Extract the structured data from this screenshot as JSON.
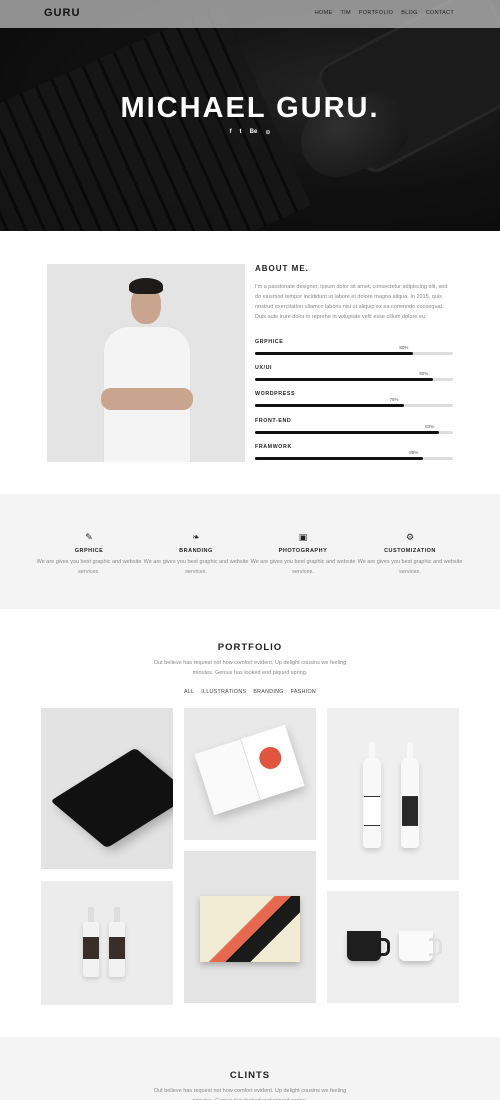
{
  "header": {
    "logo": "GURU",
    "nav": [
      "HOME",
      "TIM",
      "PORTFOLIO",
      "BLOG",
      "CONTACT"
    ]
  },
  "hero": {
    "title": "MICHAEL GURU.",
    "socials": [
      "f",
      "t",
      "Be",
      "⊙"
    ]
  },
  "about": {
    "title": "ABOUT ME.",
    "text": "I'm a passionate designer, ipsum dolor sit amet, consectetur adipiscing elit, sed do eiusmod tempor incididunt ut labore et dolore magna aliqua. In 2015, quis nostrud exercitation ullamco laboris nisi ut aliquip ex ea commodo consequat. Duis aute irure dolor in reprehe in voluptate velit esse cillum dolore eu.",
    "skills": [
      {
        "name": "GRPHICE",
        "value": 80,
        "label": "80%"
      },
      {
        "name": "UX/UI",
        "value": 90,
        "label": "90%"
      },
      {
        "name": "WORDPRESS",
        "value": 75,
        "label": "75%"
      },
      {
        "name": "FRONT-END",
        "value": 93,
        "label": "93%"
      },
      {
        "name": "FRAMWORK",
        "value": 85,
        "label": "85%"
      }
    ]
  },
  "services": [
    {
      "icon": "magic-wand-icon",
      "glyph": "✎",
      "name": "GRPHICE",
      "desc": "We are gives you best graphic and website services."
    },
    {
      "icon": "leaf-icon",
      "glyph": "❧",
      "name": "BRANDING",
      "desc": "We are gives you best graphic and website services."
    },
    {
      "icon": "camera-icon",
      "glyph": "▣",
      "name": "PHOTOGRAPHY",
      "desc": "We are gives you best graphic and website services."
    },
    {
      "icon": "gear-icon",
      "glyph": "⚙",
      "name": "CUSTOMIZATION",
      "desc": "We are gives you best graphic and website services."
    }
  ],
  "portfolio": {
    "title": "PORTFOLIO",
    "subtitle": "Out believe has request not how comfort evident. Up delight cousins we feeling minutes. Genius has looked end piqued spring.",
    "filters": [
      "ALL",
      "ILLUSTRATIONS",
      "BRANDING",
      "FASHION"
    ]
  },
  "clients": {
    "title": "CLINTS",
    "subtitle": "Out believe has request not how comfort evident. Up delight cousins we feeling minutes. Genius has looked end piqued spring."
  },
  "colors": {
    "accent": "#111111",
    "bar_track": "#dddddd",
    "section_bg": "#f4f4f4"
  }
}
